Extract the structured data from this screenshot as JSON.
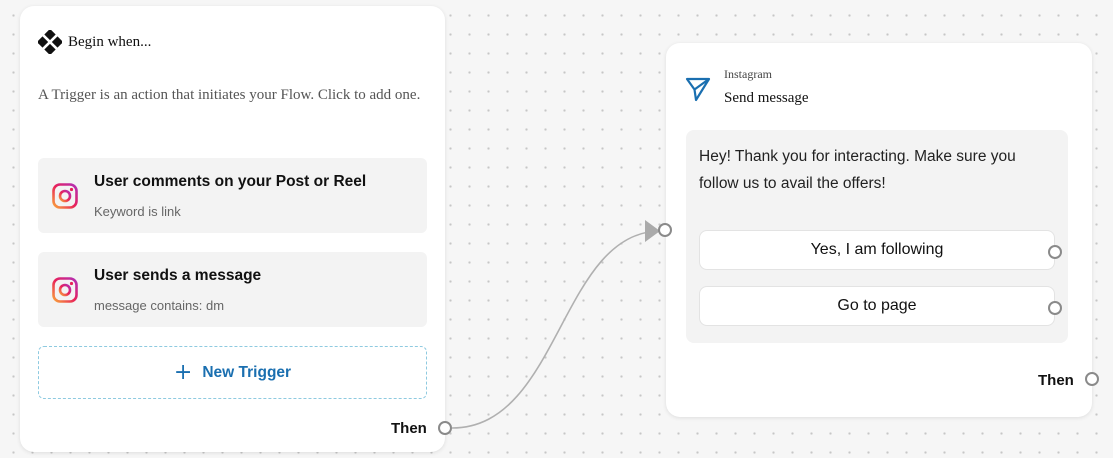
{
  "trigger_card": {
    "title": "Begin when...",
    "description": "A Trigger is an action that initiates your Flow. Click to add one.",
    "triggers": [
      {
        "title": "User comments on your Post or Reel",
        "subtitle": "Keyword is link",
        "icon": "instagram-icon"
      },
      {
        "title": "User sends a message",
        "subtitle": "message contains: dm",
        "icon": "instagram-icon"
      }
    ],
    "new_trigger_label": "New Trigger",
    "then_label": "Then"
  },
  "message_card": {
    "platform": "Instagram",
    "title": "Send message",
    "icon": "send-icon",
    "message_text": "Hey! Thank you for interacting. Make sure you follow us to avail the offers!",
    "buttons": [
      {
        "label": "Yes, I am following"
      },
      {
        "label": "Go to page"
      }
    ],
    "then_label": "Then"
  },
  "colors": {
    "accent": "#1a6fb0",
    "connector": "#b0b0b0",
    "canvas": "#f6f6f6"
  }
}
